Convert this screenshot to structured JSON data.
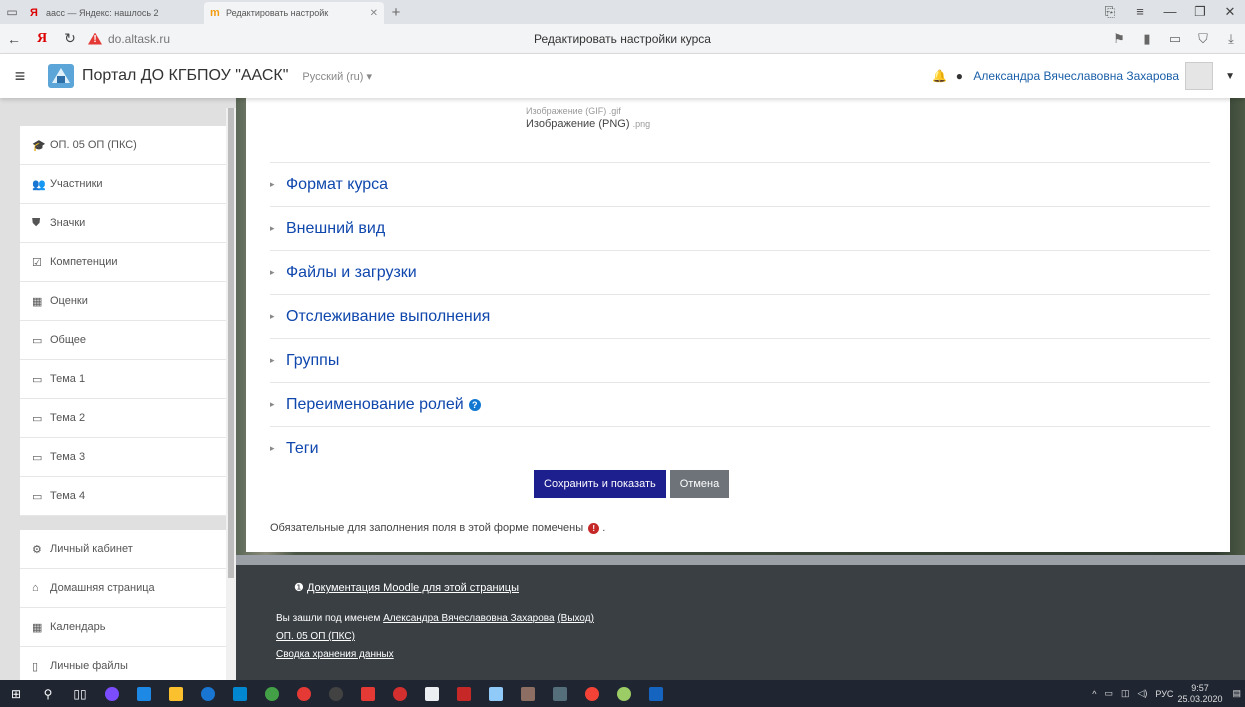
{
  "browser": {
    "tabs": [
      {
        "icon": "Я",
        "label": "аасс — Яндекс: нашлось 2",
        "active": false
      },
      {
        "icon": "m",
        "label": "Редактировать настройк",
        "active": true
      }
    ],
    "new_tab": "+",
    "address": "do.altask.ru",
    "page_title": "Редактировать настройки курса"
  },
  "navbar": {
    "site_name": "Портал ДО КГБПОУ \"ААСК\"",
    "language": "Русский (ru) ▾",
    "user_name": "Александра Вячеславовна Захарова"
  },
  "drawer": {
    "group1": [
      {
        "icon": "graduation-cap-icon",
        "glyph": "🎓",
        "label": "ОП. 05 ОП (ПКС)"
      },
      {
        "icon": "users-icon",
        "glyph": "👥",
        "label": "Участники"
      },
      {
        "icon": "shield-icon",
        "glyph": "⛊",
        "label": "Значки"
      },
      {
        "icon": "checkbox-icon",
        "glyph": "☑",
        "label": "Компетенции"
      },
      {
        "icon": "table-icon",
        "glyph": "▦",
        "label": "Оценки"
      },
      {
        "icon": "folder-icon",
        "glyph": "▭",
        "label": "Общее"
      },
      {
        "icon": "folder-icon",
        "glyph": "▭",
        "label": "Тема 1"
      },
      {
        "icon": "folder-icon",
        "glyph": "▭",
        "label": "Тема 2"
      },
      {
        "icon": "folder-icon",
        "glyph": "▭",
        "label": "Тема 3"
      },
      {
        "icon": "folder-icon",
        "glyph": "▭",
        "label": "Тема 4"
      }
    ],
    "group2": [
      {
        "icon": "dashboard-icon",
        "glyph": "⚙",
        "label": "Личный кабинет"
      },
      {
        "icon": "home-icon",
        "glyph": "⌂",
        "label": "Домашняя страница"
      },
      {
        "icon": "calendar-icon",
        "glyph": "▦",
        "label": "Календарь"
      },
      {
        "icon": "file-icon",
        "glyph": "▯",
        "label": "Личные файлы"
      }
    ]
  },
  "form": {
    "image_types_prev": "Изображение (GIF) .gif",
    "image_types_label": "Изображение (PNG)",
    "image_types_ext": ".png",
    "sections": [
      {
        "label": "Формат курса",
        "help": false
      },
      {
        "label": "Внешний вид",
        "help": false
      },
      {
        "label": "Файлы и загрузки",
        "help": false
      },
      {
        "label": "Отслеживание выполнения",
        "help": false
      },
      {
        "label": "Группы",
        "help": false
      },
      {
        "label": "Переименование ролей",
        "help": true
      },
      {
        "label": "Теги",
        "help": false
      }
    ],
    "save_button": "Сохранить и показать",
    "cancel_button": "Отмена",
    "required_note": "Обязательные для заполнения поля в этой форме помечены",
    "required_suffix": "."
  },
  "footer": {
    "doc_link": "Документация Moodle для этой страницы",
    "logged_in_prefix": "Вы зашли под именем",
    "user_link": "Александра Вячеславовна Захарова",
    "logout_link": "(Выход)",
    "course_link": "ОП. 05 ОП (ПКС)",
    "data_link": "Сводка хранения данных"
  },
  "taskbar": {
    "lang": "РУС",
    "time": "9:57",
    "date": "25.03.2020"
  }
}
